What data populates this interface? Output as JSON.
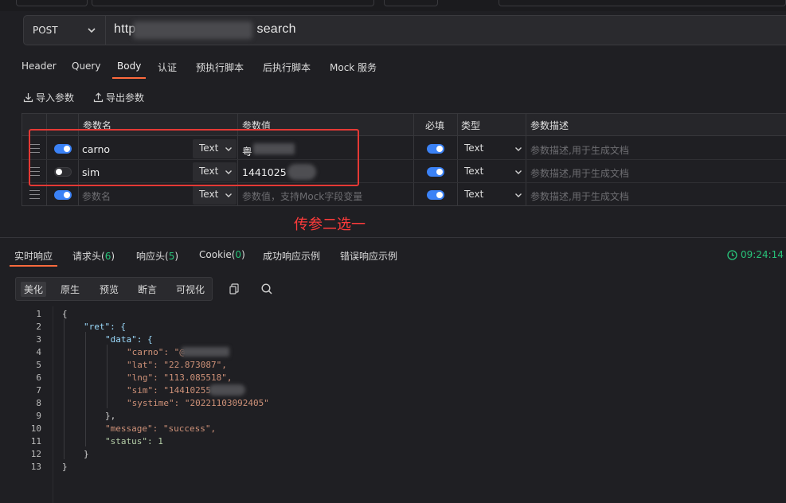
{
  "request": {
    "method": "POST",
    "url_visible_start": "http",
    "url_visible_end": "search"
  },
  "request_tabs": [
    "Header",
    "Query",
    "Body",
    "认证",
    "预执行脚本",
    "后执行脚本",
    "Mock 服务"
  ],
  "active_request_tab": "Body",
  "param_actions": {
    "import": "导入参数",
    "export": "导出参数"
  },
  "param_table": {
    "headers": {
      "name": "参数名",
      "value": "参数值",
      "required": "必填",
      "type": "类型",
      "desc": "参数描述"
    },
    "rows": [
      {
        "enabled": true,
        "name": "carno",
        "field_type": "Text",
        "value": "粤",
        "required": true,
        "type": "Text",
        "desc_placeholder": "参数描述,用于生成文档"
      },
      {
        "enabled": false,
        "name": "sim",
        "field_type": "Text",
        "value": "1441025",
        "required": true,
        "type": "Text",
        "desc_placeholder": "参数描述,用于生成文档"
      },
      {
        "enabled": true,
        "name_placeholder": "参数名",
        "field_type": "Text",
        "value_placeholder": "参数值，支持Mock字段变量",
        "required": true,
        "type": "Text",
        "desc_placeholder": "参数描述,用于生成文档"
      }
    ]
  },
  "annotation": "传参二选一",
  "response_tabs": [
    {
      "label": "实时响应",
      "count": ""
    },
    {
      "label": "请求头(",
      "count": "6",
      "suffix": ")"
    },
    {
      "label": "响应头(",
      "count": "5",
      "suffix": ")"
    },
    {
      "label": "Cookie(",
      "count": "0",
      "suffix": ")"
    },
    {
      "label": "成功响应示例",
      "count": ""
    },
    {
      "label": "错误响应示例",
      "count": ""
    }
  ],
  "response_time": "09:24:14",
  "view_modes": [
    "美化",
    "原生",
    "预览",
    "断言",
    "可视化"
  ],
  "active_view_mode": "美化",
  "json_lines": [
    "{",
    "\"ret\": {",
    "\"data\": {",
    "\"carno\": \"@",
    "\"lat\": \"22.873087\",",
    "\"lng\": \"113.085518\",",
    "\"sim\": \"14410255",
    "\"systime\": \"20221103092405\"",
    "},",
    "\"message\": \"success\",",
    "\"status\": 1",
    "}",
    "}"
  ],
  "colors": {
    "accent": "#ff6a3d",
    "toggle": "#3b82f6",
    "success": "#28c37a",
    "annotation": "#ff3b3b"
  }
}
